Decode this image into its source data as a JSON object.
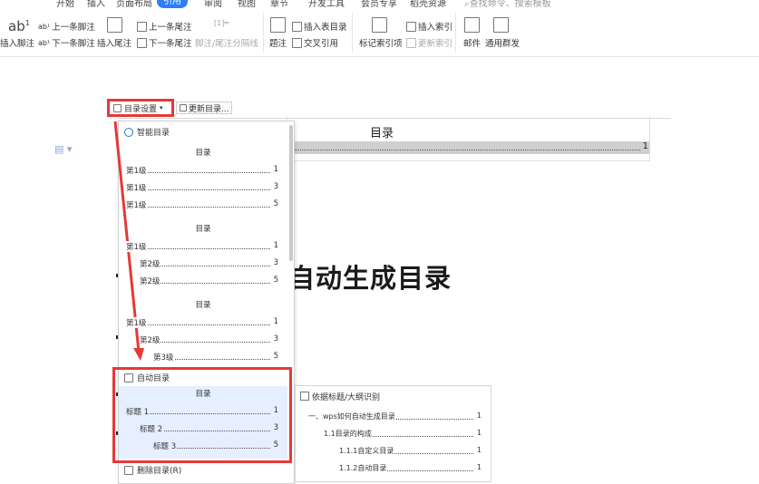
{
  "menu": {
    "tabs": [
      "开始",
      "插入",
      "页面布局",
      "引用",
      "审阅",
      "视图",
      "章节",
      "开发工具",
      "会员专享",
      "稻壳资源"
    ],
    "active_tab": "引用",
    "search_placeholder": "查找命令、搜索模板"
  },
  "ribbon": {
    "insert_footnote": "插入脚注",
    "prev_footnote": "上一条脚注",
    "next_footnote": "下一条脚注",
    "insert_endnote": "插入尾注",
    "prev_endnote": "上一条尾注",
    "next_endnote": "下一条尾注",
    "footnote_separator": "脚注/尾注分隔线",
    "caption": "题注",
    "insert_table_of_figures": "插入表目录",
    "cross_reference": "交叉引用",
    "mark_index_entry": "标记索引项",
    "insert_index": "插入索引",
    "update_index": "更新索引",
    "mail": "邮件",
    "mass_mailing": "通用群发"
  },
  "doc": {
    "toc_settings_button": "目录设置",
    "update_toc_button": "更新目录...",
    "toc_title": "目录",
    "toc_line_page": "1",
    "heading": "自动生成目录"
  },
  "dropdown": {
    "smart_toc_header": "智能目录",
    "styles": [
      {
        "title": "目录",
        "rows": [
          {
            "label": "第1级",
            "page": "1",
            "indent": 0
          },
          {
            "label": "第1级",
            "page": "3",
            "indent": 0
          },
          {
            "label": "第1级",
            "page": "5",
            "indent": 0
          }
        ]
      },
      {
        "title": "目录",
        "rows": [
          {
            "label": "第1级",
            "page": "1",
            "indent": 0
          },
          {
            "label": "第2级",
            "page": "3",
            "indent": 1
          },
          {
            "label": "第2级",
            "page": "5",
            "indent": 1
          }
        ]
      },
      {
        "title": "目录",
        "rows": [
          {
            "label": "第1级",
            "page": "1",
            "indent": 0
          },
          {
            "label": "第2级",
            "page": "3",
            "indent": 1
          },
          {
            "label": "第3级",
            "page": "5",
            "indent": 2
          }
        ]
      }
    ],
    "auto_toc_header": "自动目录",
    "auto_toc": {
      "title": "目录",
      "rows": [
        {
          "label": "标题 1",
          "page": "1",
          "indent": 0
        },
        {
          "label": "标题 2",
          "page": "3",
          "indent": 1
        },
        {
          "label": "标题 3",
          "page": "5",
          "indent": 2
        }
      ]
    },
    "delete_toc": "删除目录(R)"
  },
  "side_panel": {
    "title": "依据标题/大纲识别",
    "rows": [
      {
        "label": "一、wps如何自动生成目录",
        "page": "1",
        "indent": 0
      },
      {
        "label": "1.1目录的构成",
        "page": "1",
        "indent": 1
      },
      {
        "label": "1.1.1自定义目录",
        "page": "1",
        "indent": 2
      },
      {
        "label": "1.1.2自动目录",
        "page": "1",
        "indent": 2
      }
    ]
  },
  "colors": {
    "annotation_red": "#e53935",
    "accent_blue": "#2d7ef7",
    "auto_toc_highlight": "#e6efff"
  }
}
